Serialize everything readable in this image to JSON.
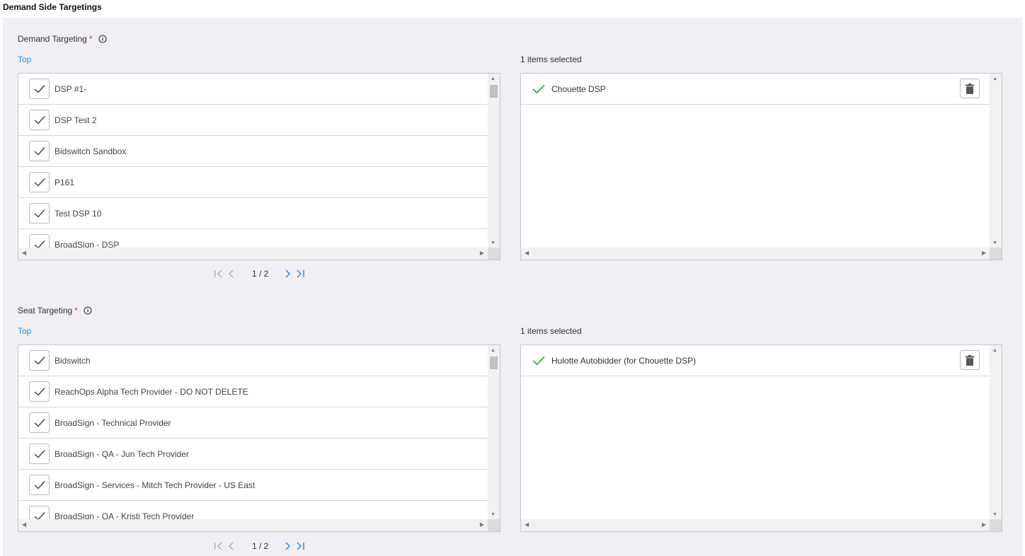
{
  "page_title": "Demand Side Targetings",
  "sections": [
    {
      "label": "Demand Targeting",
      "required_mark": "*",
      "top_link": "Top",
      "selected_count": "1 items selected",
      "items": [
        "DSP #1-",
        "DSP Test 2",
        "Bidswitch Sandbox",
        "P161",
        "Test DSP 10",
        "BroadSign - DSP"
      ],
      "selected": [
        "Chouette DSP"
      ],
      "pager": "1 / 2"
    },
    {
      "label": "Seat Targeting",
      "required_mark": "*",
      "top_link": "Top",
      "selected_count": "1 items selected",
      "items": [
        "Bidswitch",
        "ReachOps Alpha Tech Provider - DO NOT DELETE",
        "BroadSign - Technical Provider",
        "BroadSign - QA - Jun Tech Provider",
        "BroadSign - Services - Mitch Tech Provider - US East",
        "BroadSign - QA - Kristi Tech Provider"
      ],
      "selected": [
        "Hulotte Autobidder (for Chouette DSP)"
      ],
      "pager": "1 / 2"
    }
  ],
  "icons": {
    "info": "info-icon",
    "checkbox": "checkmark-icon",
    "selected_check": "green-check-icon",
    "delete": "trash-icon"
  },
  "colors": {
    "link": "#2f8fdc",
    "required": "#e53935",
    "check_green": "#3aaa35",
    "panel_bg": "#efeff4"
  }
}
